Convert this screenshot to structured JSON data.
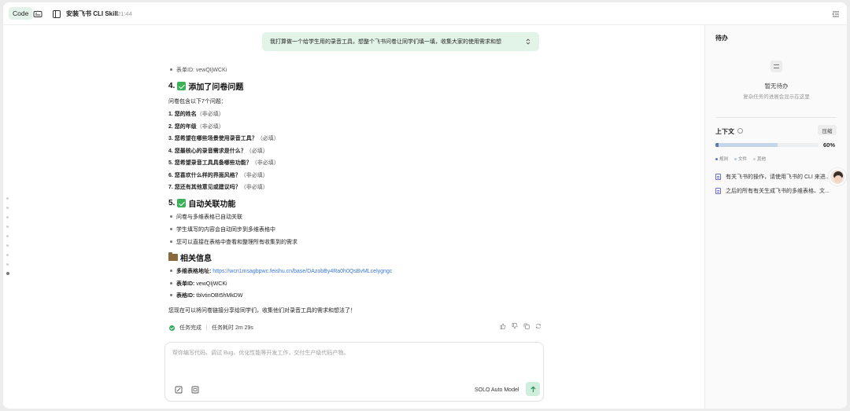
{
  "topbar": {
    "code_label": "Code",
    "title": "安装飞书 CLI Skill",
    "time": "21:44"
  },
  "chat": {
    "user_message": "我打算做一个给学生用的录音工具，想整个飞书问卷让同学们填一填，收集大家的使用需求和想",
    "form_id_top": "表单ID: vewQIjWCKi",
    "section4_title": "4. ✅ 添加了问卷问题",
    "section4_title_text": "4.",
    "section4_title_rest": "添加了问卷问题",
    "questions_intro": "问卷包含以下7个问题：",
    "questions": [
      {
        "text": "1. 您的姓名",
        "note": "（非必填）"
      },
      {
        "text": "2. 您的年级",
        "note": "（非必填）"
      },
      {
        "text": "3. 您希望在哪些场景使用录音工具？",
        "note": "（必填）"
      },
      {
        "text": "4. 您最核心的录音需求是什么？",
        "note": "（必填）"
      },
      {
        "text": "5. 您希望录音工具具备哪些功能？",
        "note": "（非必填）"
      },
      {
        "text": "6. 您喜欢什么样的界面风格？",
        "note": "（非必填）"
      },
      {
        "text": "7. 您还有其他意见或建议吗？",
        "note": "（非必填）"
      }
    ],
    "section5_title_text": "5.",
    "section5_title_rest": "自动关联功能",
    "section5_items": [
      "问卷与多维表格已自动关联",
      "学生填写的内容会自动同步到多维表格中",
      "您可以直接在表格中查看和整理所有收集到的需求"
    ],
    "info_title": "相关信息",
    "info": {
      "table_url_label": "多维表格地址:",
      "table_url": "https://wcn1msagbpwc.feishu.cn/base/DAzobBy4Ra0h0QsBvMLcelygngc",
      "form_id_label": "表单ID:",
      "form_id": "vewQIjWCKi",
      "table_id_label": "表格ID:",
      "table_id": "tblvtinOBt5hMkDW"
    },
    "closing": "您现在可以将问卷链接分享给同学们，收集他们对录音工具的需求和想法了！",
    "status_done": "任务完成",
    "status_duration": "任务耗时 2m 29s"
  },
  "input": {
    "placeholder": "帮你编写代码、调试 Bug、优化性能等开发工作，交付生产级代码产物。",
    "model": "SOLO Auto Model",
    "send_icon": "arrow-up-icon"
  },
  "panel": {
    "todo_title": "待办",
    "empty_title": "暂无待办",
    "empty_sub": "复杂任务的进展会显示在这里",
    "context_title": "上下文",
    "compress_label": "压缩",
    "context_usage": 0.6,
    "context_pct": "60%",
    "legend": [
      {
        "label": "规则",
        "color": "#5e7aa6"
      },
      {
        "label": "文件",
        "color": "#b9c9dc"
      },
      {
        "label": "其他",
        "color": "#cfcfcf"
      }
    ],
    "items": [
      "有关飞书的操作，请使用飞书的 CLI 来进...",
      "之后的所有有关生成飞书的多维表格、文..."
    ]
  },
  "colors": {
    "accent": "#2ea85a",
    "bubble": "#e2f3e8",
    "link": "#3a78d6"
  }
}
